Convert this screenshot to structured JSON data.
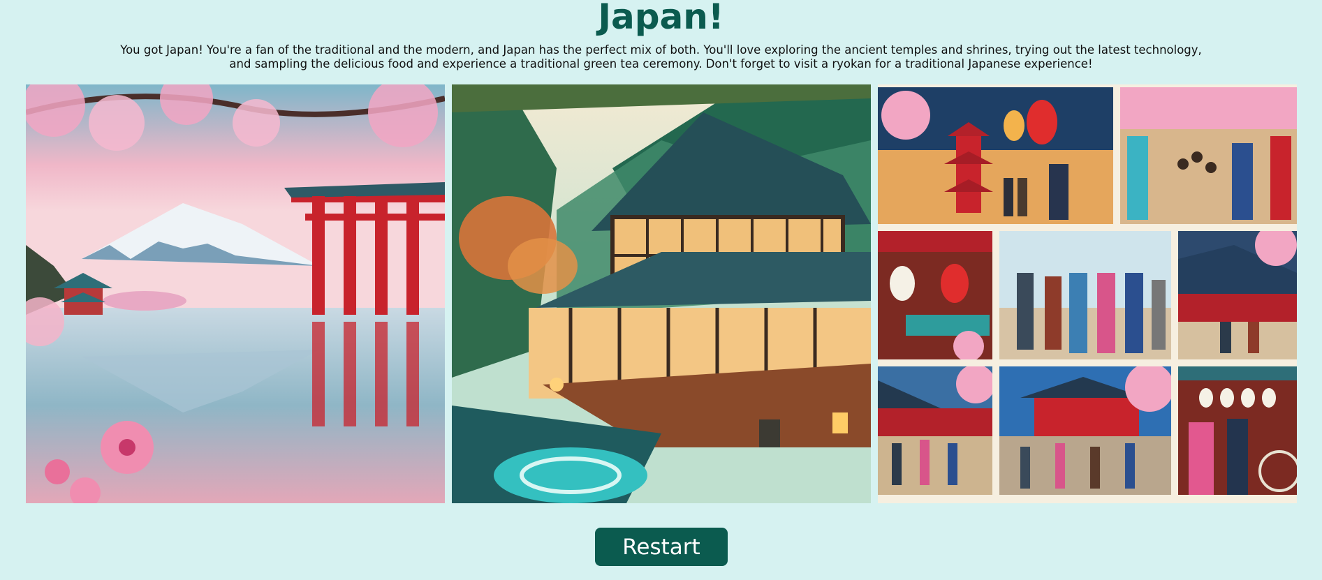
{
  "result": {
    "title": "Japan!",
    "description": "You got Japan! You're a fan of the traditional and the modern, and Japan has the perfect mix of both. You'll love exploring the ancient temples and shrines, trying out the latest technology, and sampling the delicious food and experience a traditional green tea ceremony. Don't forget to visit a ryokan for a traditional Japanese experience!"
  },
  "images": [
    {
      "name": "mount-fuji-torii-lake-image"
    },
    {
      "name": "ryokan-hot-spring-image"
    },
    {
      "name": "japan-street-scenes-collage-image"
    }
  ],
  "actions": {
    "restart_label": "Restart"
  },
  "colors": {
    "background": "#d6f2f1",
    "title": "#0b5b4f",
    "button": "#0b5b4f"
  }
}
